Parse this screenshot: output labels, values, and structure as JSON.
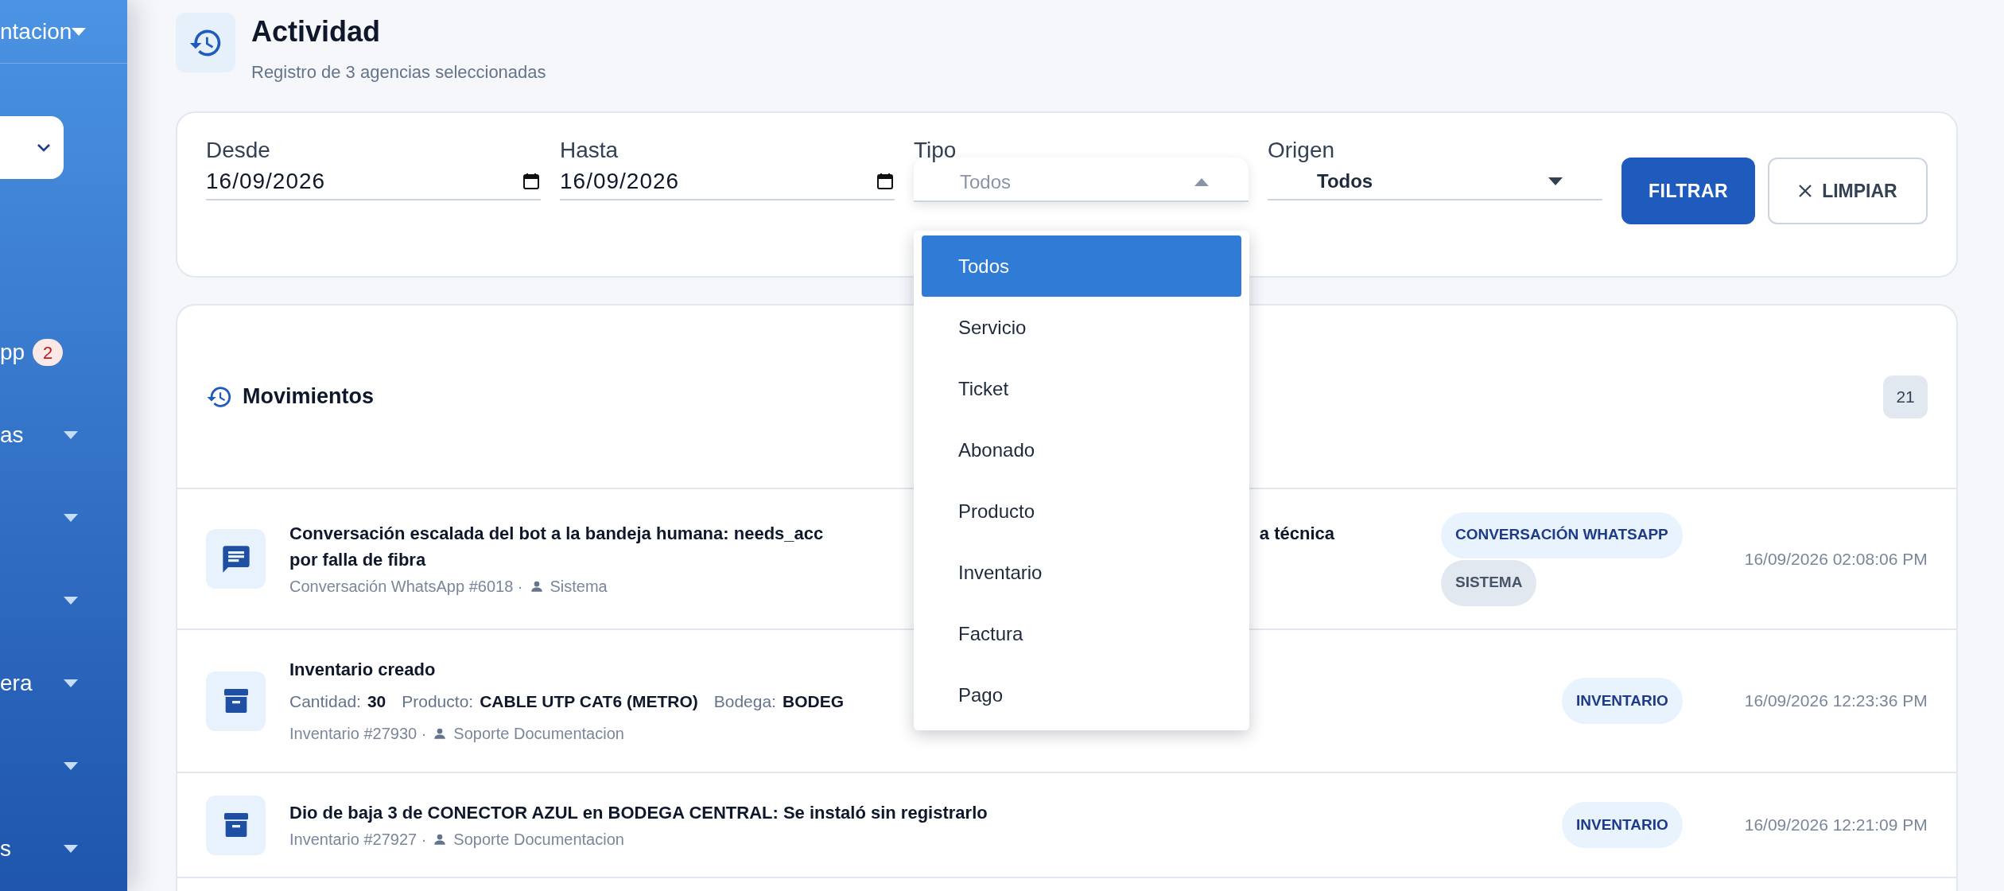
{
  "sidebar": {
    "header": {
      "label": "ntacion",
      "caret": true
    },
    "select": {
      "expanded": false
    },
    "items": [
      {
        "label": "pp",
        "badge": "2",
        "caret": false
      },
      {
        "label": "as",
        "caret": true
      },
      {
        "caret": true
      },
      {
        "caret": true
      },
      {
        "label": "era",
        "caret": true
      },
      {
        "caret": true
      },
      {
        "label": "s",
        "caret": true
      }
    ]
  },
  "page": {
    "title": "Actividad",
    "subtitle": "Registro de 3 agencias seleccionadas"
  },
  "filters": {
    "fields": [
      {
        "kind": "date",
        "label": "Desde",
        "value": "16/09/2026"
      },
      {
        "kind": "date",
        "label": "Hasta",
        "value": "16/09/2026"
      },
      {
        "kind": "select",
        "label": "Tipo",
        "value": "Todos",
        "expanded": true,
        "options": [
          {
            "label": "Todos",
            "selected": true
          },
          {
            "label": "Servicio",
            "selected": false
          },
          {
            "label": "Ticket",
            "selected": false
          },
          {
            "label": "Abonado",
            "selected": false
          },
          {
            "label": "Producto",
            "selected": false
          },
          {
            "label": "Inventario",
            "selected": false
          },
          {
            "label": "Factura",
            "selected": false
          },
          {
            "label": "Pago",
            "selected": false
          }
        ]
      },
      {
        "kind": "select",
        "label": "Origen",
        "value": "Todos",
        "expanded": false
      }
    ],
    "buttons": [
      {
        "kind": "primary",
        "label": "FILTRAR"
      },
      {
        "kind": "clear",
        "label": "LIMPIAR"
      }
    ]
  },
  "movements": {
    "title": "Movimientos",
    "count": "21",
    "rows": [
      {
        "kind": "conversation",
        "title_lines": [
          [
            "Conversación escalada del bot a la bandeja humana: needs_acc",
            "a técnica"
          ],
          [
            "por falla de fibra"
          ]
        ],
        "reference": "Conversación WhatsApp #6018 ·",
        "user": "Sistema",
        "tags": [
          {
            "label": "CONVERSACIÓN WHATSAPP",
            "kind": "type"
          },
          {
            "label": "SISTEMA",
            "kind": "origin"
          }
        ],
        "time": "16/09/2026 02:08:06 PM"
      },
      {
        "kind": "inventory",
        "title_lines": [
          [
            "Inventario creado"
          ]
        ],
        "details": [
          {
            "label": "Cantidad:",
            "value": "30"
          },
          {
            "label": "Producto:",
            "value": "CABLE UTP CAT6 (METRO)"
          },
          {
            "label": "Bodega:",
            "value": "BODEG"
          }
        ],
        "reference": "Inventario #27930 ·",
        "user": "Soporte Documentacion",
        "tags": [
          {
            "label": "INVENTARIO",
            "kind": "type"
          }
        ],
        "time": "16/09/2026 12:23:36 PM"
      },
      {
        "kind": "inventory",
        "title_lines": [
          [
            "Dio de baja 3 de CONECTOR AZUL en BODEGA CENTRAL: Se instaló sin registrarlo"
          ]
        ],
        "reference": "Inventario #27927 ·",
        "user": "Soporte Documentacion",
        "tags": [
          {
            "label": "INVENTARIO",
            "kind": "type"
          }
        ],
        "time": "16/09/2026 12:21:09 PM"
      }
    ]
  }
}
